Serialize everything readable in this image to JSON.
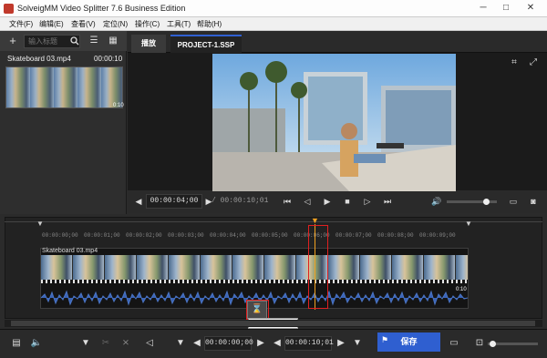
{
  "window": {
    "title": "SolveigMM Video Splitter 7.6 Business Edition"
  },
  "menu": [
    "文件(F)",
    "编辑(E)",
    "查看(V)",
    "定位(N)",
    "操作(C)",
    "工具(T)",
    "帮助(H)"
  ],
  "library": {
    "search_placeholder": "输入标题",
    "clip": {
      "name": "Skateboard 03.mp4",
      "duration": "00:00:10",
      "thumb_time": "0:10"
    }
  },
  "tabs": [
    "播放",
    "PROJECT-1.SSP"
  ],
  "player": {
    "current_time": "00:00:04;00",
    "total_time": "/ 00:00:10;01"
  },
  "timeline": {
    "ticks": [
      "00:00:00;00",
      "00:00:01;00",
      "00:00:02;00",
      "00:00:03;00",
      "00:00:04;00",
      "00:00:05;00",
      "00:00:06;00",
      "00:00:07;00",
      "00:00:08;00",
      "00:00:09;00"
    ],
    "clip_label": "Skateboard 03.mp4",
    "clip_end_label": "0:10"
  },
  "tooltip": "添加选区段 (D)",
  "bottom": {
    "start_time": "00:00:00;00",
    "end_time": "00:00:10;01",
    "save_label": "保存"
  },
  "colors": {
    "accent": "#2f5fd0",
    "highlight": "#e02020",
    "playhead": "#f0a020",
    "wave": "#4a74c4"
  }
}
